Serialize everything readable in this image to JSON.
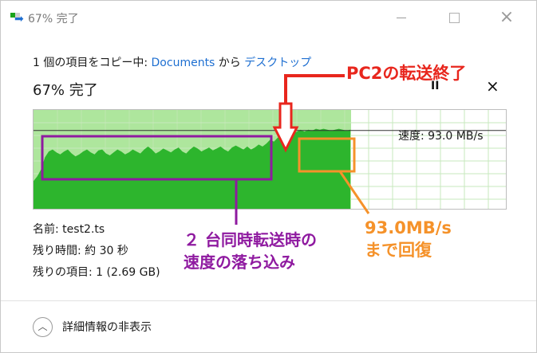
{
  "window": {
    "title": "67% 完了",
    "buttons": {
      "minimize": "minimize",
      "maximize": "maximize",
      "close": "×"
    }
  },
  "copy": {
    "prefix": "1 個の項目をコピー中: ",
    "source": "Documents",
    "mid": " から ",
    "destination": "デスクトップ"
  },
  "progress": {
    "label": "67% 完了",
    "percent": 67
  },
  "controls": {
    "pause": "II",
    "cancel": "×"
  },
  "chart_data": {
    "type": "area",
    "progress_fraction": 0.67,
    "current_speed_label": "速度: 93.0 MB/s",
    "fill_color": "#2db52d",
    "progress_bg": "#aee69d",
    "grid_color": "#c7e8bd",
    "series": [
      {
        "values": [
          0.28,
          0.33,
          0.4,
          0.52,
          0.58,
          0.6,
          0.57,
          0.55,
          0.58,
          0.6,
          0.56,
          0.53,
          0.55,
          0.58,
          0.6,
          0.57,
          0.55,
          0.59,
          0.6,
          0.56,
          0.54,
          0.57,
          0.6,
          0.58,
          0.55,
          0.57,
          0.6,
          0.58,
          0.56,
          0.6,
          0.63,
          0.6,
          0.56,
          0.58,
          0.61,
          0.59,
          0.57,
          0.6,
          0.62,
          0.58,
          0.56,
          0.6,
          0.63,
          0.61,
          0.58,
          0.6,
          0.62,
          0.59,
          0.61,
          0.63,
          0.6,
          0.58,
          0.62,
          0.64,
          0.62,
          0.6,
          0.63,
          0.6,
          0.62,
          0.65,
          0.63,
          0.66,
          0.7,
          0.68,
          0.72,
          0.75,
          0.72,
          0.74,
          0.76,
          0.78,
          0.8,
          0.78,
          0.8,
          0.79,
          0.81,
          0.8,
          0.81,
          0.8,
          0.79,
          0.8,
          0.81,
          0.8,
          0.79,
          0.8
        ]
      }
    ]
  },
  "file": {
    "name_label": "名前: ",
    "name_value": "test2.ts",
    "time_label": "残り時間: ",
    "time_value": "約 30 秒",
    "items_label": "残りの項目: ",
    "items_value": "1 (2.69 GB)"
  },
  "footer": {
    "toggle_icon": "chevron-up-icon",
    "details_label": "詳細情報の非表示"
  },
  "annotations": {
    "pc2_end": "PC2の転送終了",
    "slowdown_line1": "２ 台同時転送時の",
    "slowdown_line2": "速度の落ち込み",
    "recovery_line1": "93.0MB/s",
    "recovery_line2": "まで回復",
    "colors": {
      "red": "#e8261d",
      "purple": "#8f1aa0",
      "orange": "#f5922a"
    }
  }
}
